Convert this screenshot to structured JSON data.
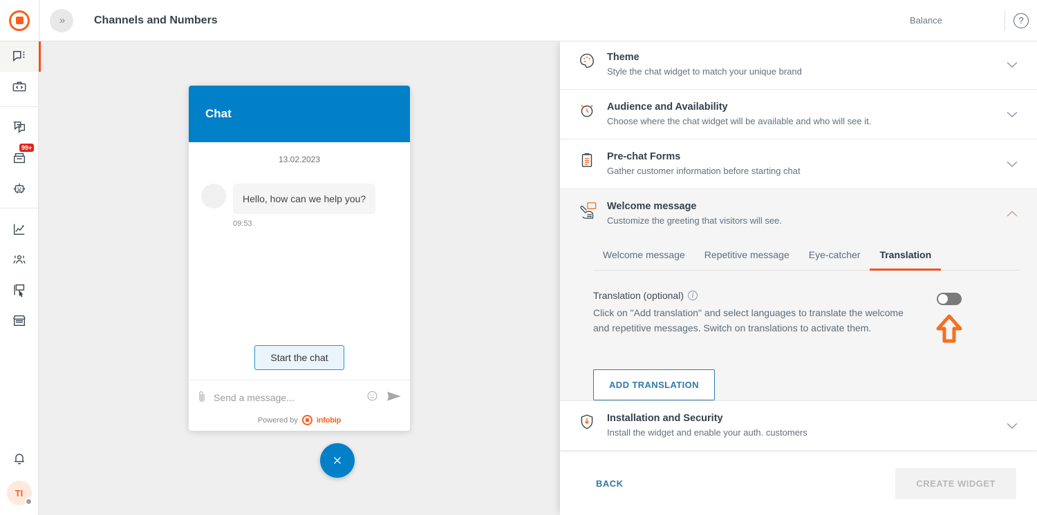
{
  "topbar": {
    "logo_name": "infobip-logo",
    "collapse_label": "»",
    "title": "Channels and Numbers",
    "balance_label": "Balance",
    "help_label": "?"
  },
  "sidebar": {
    "groups": [
      {
        "items": [
          {
            "name": "conversations",
            "icon": "chat-bubble-icon",
            "active": true,
            "badge": ""
          },
          {
            "name": "developer-tools",
            "icon": "code-briefcase-icon",
            "active": false,
            "badge": ""
          }
        ]
      },
      {
        "items": [
          {
            "name": "broadcast",
            "icon": "chat-copy-icon",
            "active": false,
            "badge": ""
          },
          {
            "name": "inbox",
            "icon": "inbox-tray-icon",
            "active": false,
            "badge": "99+"
          },
          {
            "name": "answers-bot",
            "icon": "robot-icon",
            "active": false,
            "badge": ""
          }
        ]
      },
      {
        "items": [
          {
            "name": "analyze",
            "icon": "line-chart-icon",
            "active": false,
            "badge": ""
          },
          {
            "name": "people",
            "icon": "people-icon",
            "active": false,
            "badge": ""
          },
          {
            "name": "moments",
            "icon": "flow-cursor-icon",
            "active": false,
            "badge": ""
          },
          {
            "name": "exchange",
            "icon": "storefront-icon",
            "active": false,
            "badge": ""
          }
        ]
      }
    ],
    "bottom": {
      "notifications_icon": "bell-icon",
      "avatar_initials": "TI",
      "avatar_status": "away"
    }
  },
  "preview": {
    "widget": {
      "header_title": "Chat",
      "header_color": "#0180c8",
      "date": "13.02.2023",
      "messages": [
        {
          "text": "Hello, how can we help you?",
          "time": "09:53",
          "from": "agent"
        }
      ],
      "start_button": "Start the chat",
      "input_placeholder": "Send a message...",
      "attachment_icon": "paperclip-icon",
      "emoji_icon": "smiley-icon",
      "send_icon": "send-icon",
      "powered_by": "Powered by",
      "powered_brand": "infobip"
    },
    "launcher": {
      "icon": "close-x-icon",
      "color": "#0180c8"
    }
  },
  "panel": {
    "sections": [
      {
        "id": "theme",
        "icon": "palette-icon",
        "title": "Theme",
        "subtitle": "Style the chat widget to match your unique brand",
        "expanded": false,
        "chevron": "chevron-down-icon"
      },
      {
        "id": "audience",
        "icon": "clock-alarm-icon",
        "title": "Audience and Availability",
        "subtitle": "Choose where the chat widget will be available and who will see it.",
        "expanded": false,
        "chevron": "chevron-down-icon"
      },
      {
        "id": "prechat",
        "icon": "clipboard-icon",
        "title": "Pre-chat Forms",
        "subtitle": "Gather customer information before starting chat",
        "expanded": false,
        "chevron": "chevron-down-icon"
      },
      {
        "id": "welcome",
        "icon": "hand-click-icon",
        "title": "Welcome message",
        "subtitle": "Customize the greeting that visitors will see.",
        "expanded": true,
        "chevron": "chevron-up-icon"
      },
      {
        "id": "installation",
        "icon": "shield-download-icon",
        "title": "Installation and Security",
        "subtitle": "Install the widget and enable your auth. customers",
        "expanded": false,
        "chevron": "chevron-down-icon"
      }
    ],
    "welcome": {
      "tabs": [
        {
          "label": "Welcome message",
          "active": false
        },
        {
          "label": "Repetitive message",
          "active": false
        },
        {
          "label": "Eye-catcher",
          "active": false
        },
        {
          "label": "Translation",
          "active": true
        }
      ],
      "translation": {
        "label": "Translation (optional)",
        "info_icon": "info-icon",
        "description": "Click on \"Add translation\" and select languages to translate the welcome and repetitive messages. Switch on translations to activate them.",
        "toggle_state": "off",
        "add_button": "ADD TRANSLATION",
        "highlight_arrow": "arrow-up-highlight",
        "highlight_color": "#f4701f"
      }
    },
    "footer": {
      "back_label": "BACK",
      "create_label": "CREATE WIDGET",
      "create_disabled": true
    }
  },
  "colors": {
    "brand_orange": "#f4511e",
    "accent_blue": "#0180c8",
    "link_blue": "#2f7aa8",
    "canvas_gray": "#efefef"
  }
}
